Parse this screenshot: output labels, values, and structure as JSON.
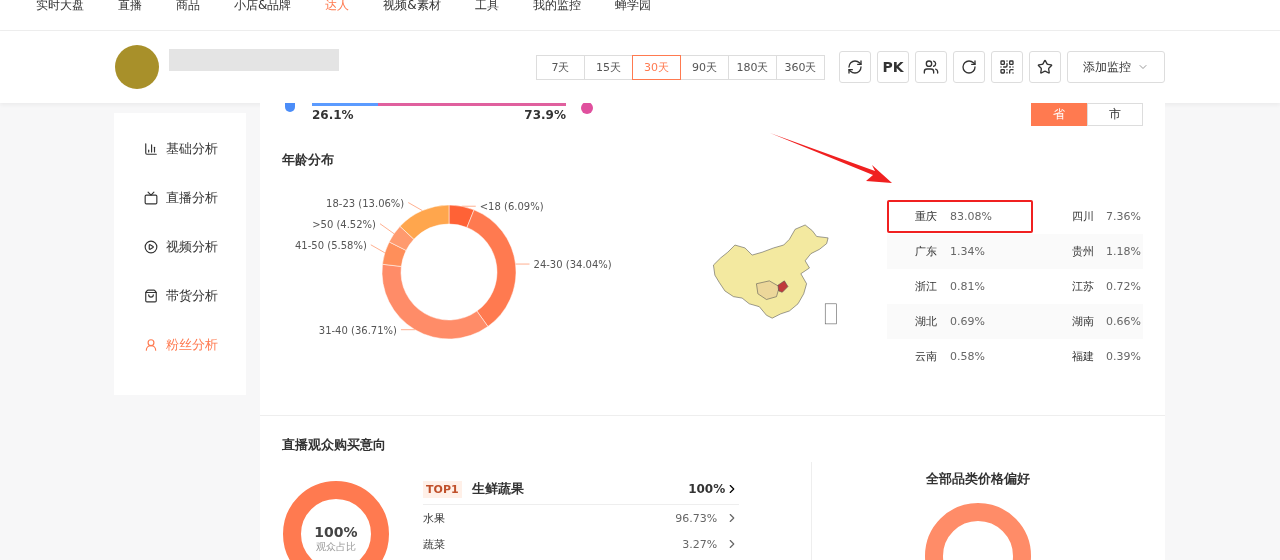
{
  "top_nav": {
    "items": [
      {
        "label": "实时大盘",
        "selected": false
      },
      {
        "label": "直播",
        "selected": false
      },
      {
        "label": "商品",
        "selected": false
      },
      {
        "label": "小店&品牌",
        "selected": false
      },
      {
        "label": "达人",
        "selected": true
      },
      {
        "label": "视频&素材",
        "selected": false
      },
      {
        "label": "工具",
        "selected": false
      },
      {
        "label": "我的监控",
        "selected": false
      },
      {
        "label": "蝉学园",
        "selected": false
      }
    ]
  },
  "header": {
    "period_tabs": [
      {
        "label": "7天",
        "selected": false
      },
      {
        "label": "15天",
        "selected": false
      },
      {
        "label": "30天",
        "selected": true
      },
      {
        "label": "90天",
        "selected": false
      },
      {
        "label": "180天",
        "selected": false
      },
      {
        "label": "360天",
        "selected": false
      }
    ],
    "pk_label": "PK",
    "monitor_button": "添加监控"
  },
  "sidebar": {
    "items": [
      {
        "label": "基础分析",
        "kind": "chart",
        "selected": false
      },
      {
        "label": "直播分析",
        "kind": "live",
        "selected": false
      },
      {
        "label": "视频分析",
        "kind": "video",
        "selected": false
      },
      {
        "label": "带货分析",
        "kind": "bag",
        "selected": false
      },
      {
        "label": "粉丝分析",
        "kind": "fans",
        "selected": true
      }
    ]
  },
  "gender": {
    "male_share": "26.1%",
    "female_share": "73.9%",
    "level": 0.261
  },
  "region_toggle": [
    {
      "label": "省",
      "selected": true
    },
    {
      "label": "市",
      "selected": false
    }
  ],
  "age": {
    "title": "年龄分布",
    "chart_data": {
      "type": "donut",
      "categories": [
        "<18 (6.09%)",
        "24-30 (34.04%)",
        "31-40 (36.71%)",
        "41-50 (5.58%)",
        ">50 (4.52%)",
        "18-23 (13.06%)"
      ],
      "values": [
        6.09,
        34.04,
        36.71,
        5.58,
        4.52,
        13.06
      ]
    }
  },
  "regions": [
    [
      {
        "name": "重庆",
        "share": "83.08%",
        "highlighted": true
      },
      {
        "name": "四川",
        "share": "7.36%",
        "highlighted": false
      }
    ],
    [
      {
        "name": "广东",
        "share": "1.34%",
        "highlighted": false
      },
      {
        "name": "贵州",
        "share": "1.18%",
        "highlighted": false
      }
    ],
    [
      {
        "name": "浙江",
        "share": "0.81%",
        "highlighted": false
      },
      {
        "name": "江苏",
        "share": "0.72%",
        "highlighted": false
      }
    ],
    [
      {
        "name": "湖北",
        "share": "0.69%",
        "highlighted": false
      },
      {
        "name": "湖南",
        "share": "0.66%",
        "highlighted": false
      }
    ],
    [
      {
        "name": "云南",
        "share": "0.58%",
        "highlighted": false
      },
      {
        "name": "福建",
        "share": "0.39%",
        "highlighted": false
      }
    ]
  ],
  "purchase": {
    "title": "直播观众购买意向",
    "ring_value": "100%",
    "ring_caption": "观众占比",
    "top_badge": "TOP1",
    "top_category": "生鲜蔬果",
    "top_share": "100%",
    "items": [
      {
        "label": "水果",
        "share": "96.73%"
      },
      {
        "label": "蔬菜",
        "share": "3.27%"
      }
    ],
    "price_title": "全部品类价格偏好"
  }
}
